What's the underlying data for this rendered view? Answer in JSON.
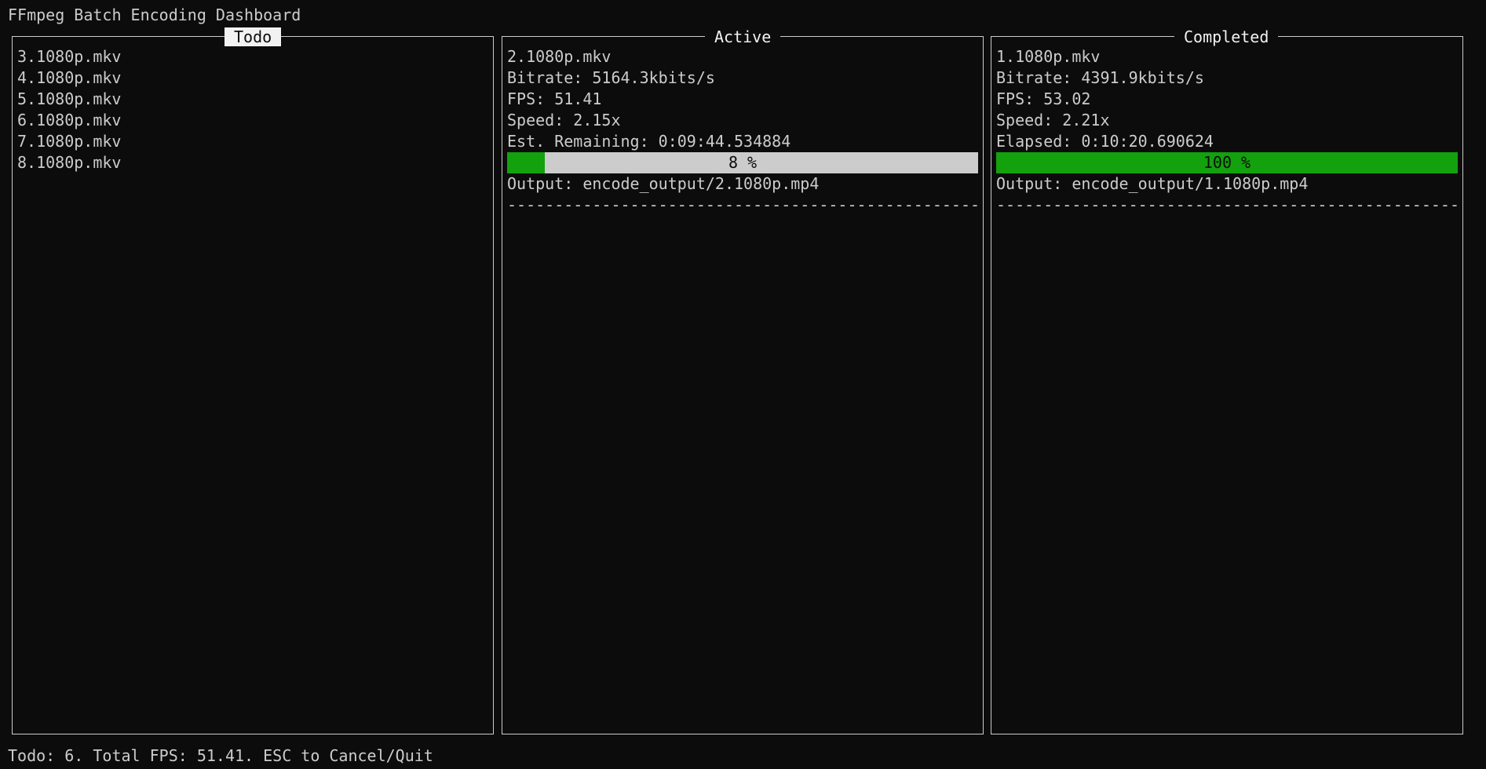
{
  "app": {
    "title": "FFmpeg Batch Encoding Dashboard"
  },
  "todo": {
    "title": "Todo",
    "items": [
      "3.1080p.mkv",
      "4.1080p.mkv",
      "5.1080p.mkv",
      "6.1080p.mkv",
      "7.1080p.mkv",
      "8.1080p.mkv"
    ]
  },
  "active": {
    "title": "Active",
    "file": "2.1080p.mkv",
    "bitrate": "Bitrate: 5164.3kbits/s",
    "fps": "FPS: 51.41",
    "speed": "Speed: 2.15x",
    "remaining": "Est. Remaining: 0:09:44.534884",
    "progress_percent": 8,
    "progress_label": "8 %",
    "output": "Output: encode_output/2.1080p.mp4",
    "separator": "--------------------------------------------------------------------------------"
  },
  "completed": {
    "title": "Completed",
    "file": "1.1080p.mkv",
    "bitrate": "Bitrate: 4391.9kbits/s",
    "fps": "FPS: 53.02",
    "speed": "Speed: 2.21x",
    "elapsed": "Elapsed: 0:10:20.690624",
    "progress_percent": 100,
    "progress_label": "100 %",
    "output": "Output: encode_output/1.1080p.mp4",
    "separator": "--------------------------------------------------------------------------------"
  },
  "status_bar": {
    "text": "Todo: 6. Total FPS: 51.41. ESC to Cancel/Quit"
  },
  "colors": {
    "background": "#0c0c0c",
    "text": "#cccccc",
    "progress_fill": "#13a10e",
    "progress_track": "#cccccc",
    "selected_title_bg": "#f2f2f2"
  }
}
